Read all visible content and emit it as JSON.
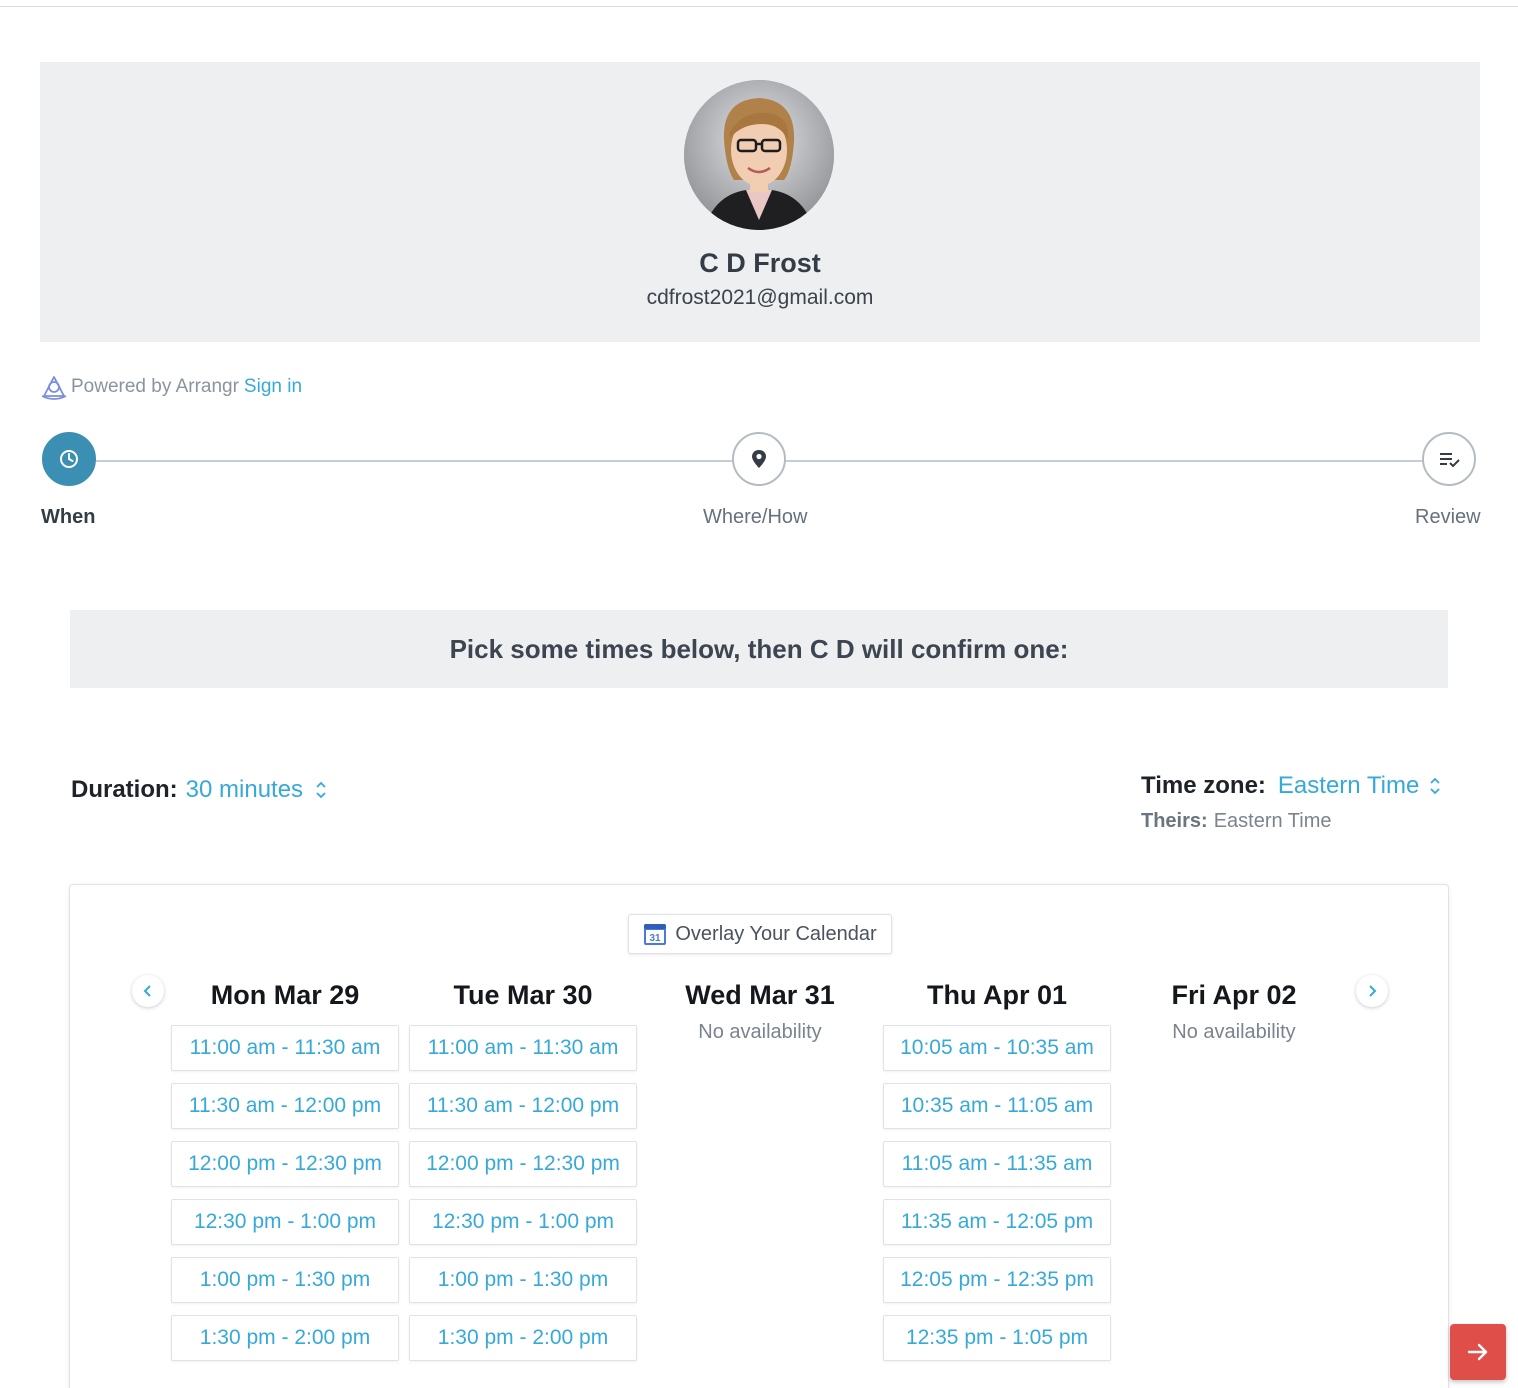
{
  "profile": {
    "name": "C D Frost",
    "email": "cdfrost2021@gmail.com",
    "avatar_icon": "person-photo"
  },
  "footer_brand": {
    "powered_text": "Powered by Arrangr",
    "signin_label": "Sign in"
  },
  "steps": [
    {
      "label": "When",
      "icon": "clock-icon",
      "active": true
    },
    {
      "label": "Where/How",
      "icon": "map-pin-icon",
      "active": false
    },
    {
      "label": "Review",
      "icon": "checklist-icon",
      "active": false
    }
  ],
  "instruction": "Pick some times below, then C D will confirm one:",
  "duration": {
    "label": "Duration:",
    "value": "30 minutes"
  },
  "timezone": {
    "label": "Time zone:",
    "value": "Eastern Time",
    "theirs_label": "Theirs:",
    "theirs_value": "Eastern Time"
  },
  "calendar": {
    "overlay_label": "Overlay Your Calendar",
    "overlay_icon_text": "31",
    "days": [
      {
        "title": "Mon Mar 29",
        "no_availability": "",
        "slots": [
          "11:00 am - 11:30 am",
          "11:30 am - 12:00 pm",
          "12:00 pm - 12:30 pm",
          "12:30 pm - 1:00 pm",
          "1:00 pm - 1:30 pm",
          "1:30 pm - 2:00 pm"
        ]
      },
      {
        "title": "Tue Mar 30",
        "no_availability": "",
        "slots": [
          "11:00 am - 11:30 am",
          "11:30 am - 12:00 pm",
          "12:00 pm - 12:30 pm",
          "12:30 pm - 1:00 pm",
          "1:00 pm - 1:30 pm",
          "1:30 pm - 2:00 pm"
        ]
      },
      {
        "title": "Wed Mar 31",
        "no_availability": "No availability",
        "slots": []
      },
      {
        "title": "Thu Apr 01",
        "no_availability": "",
        "slots": [
          "10:05 am - 10:35 am",
          "10:35 am - 11:05 am",
          "11:05 am - 11:35 am",
          "11:35 am - 12:05 pm",
          "12:05 pm - 12:35 pm",
          "12:35 pm - 1:05 pm"
        ]
      },
      {
        "title": "Fri Apr 02",
        "no_availability": "No availability",
        "slots": []
      }
    ]
  },
  "colors": {
    "accent": "#36a9d9",
    "step_active": "#3a8fb3",
    "fab": "#e04e4a"
  }
}
